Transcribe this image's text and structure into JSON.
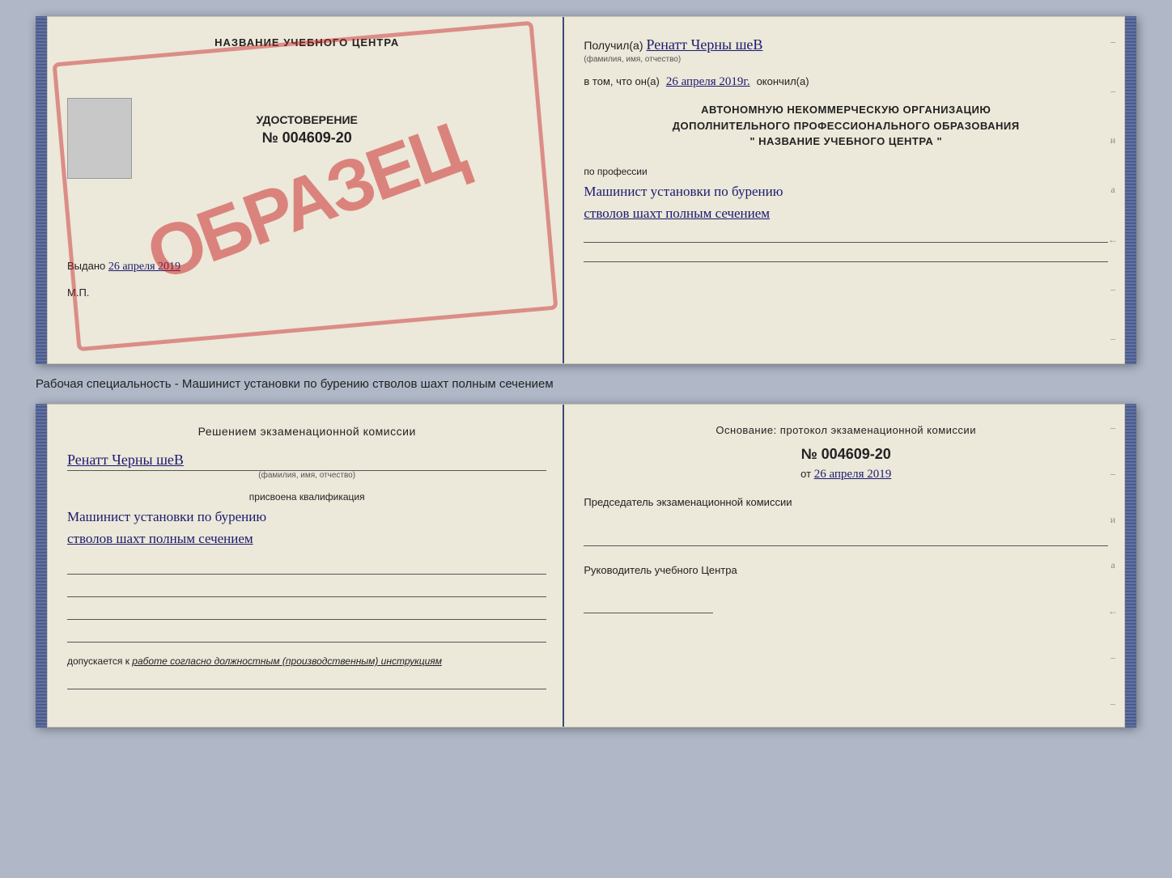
{
  "top_cert": {
    "left": {
      "title": "НАЗВАНИЕ УЧЕБНОГО ЦЕНТРА",
      "stamp": "ОБРАЗЕЦ",
      "stamp_border": true,
      "udostoverenie": "УДОСТОВЕРЕНИЕ",
      "number": "№ 004609-20",
      "photo": true,
      "vydano_label": "Выдано",
      "vydano_date": "26 апреля 2019",
      "mp": "М.П."
    },
    "right": {
      "poluchil": "Получил(а)",
      "name_handwritten": "Ренатт Черны шеВ",
      "name_hint": "(фамилия, имя, отчество)",
      "vtom_label": "в том, что он(а)",
      "date_handwritten": "26 апреля 2019г.",
      "okonchil": "окончил(а)",
      "org_line1": "АВТОНОМНУЮ НЕКОММЕРЧЕСКУЮ ОРГАНИЗАЦИЮ",
      "org_line2": "ДОПОЛНИТЕЛЬНОГО ПРОФЕССИОНАЛЬНОГО ОБРАЗОВАНИЯ",
      "org_line3": "\"  НАЗВАНИЕ УЧЕБНОГО ЦЕНТРА  \"",
      "po_professii": "по профессии",
      "profession_line1": "Машинист установки по бурению",
      "profession_line2": "стволов шахт полным сечением",
      "side_chars": [
        "–",
        "–",
        "и",
        "а",
        "←",
        "–",
        "–"
      ]
    }
  },
  "specialty_label": "Рабочая специальность - Машинист установки по бурению стволов шахт полным сечением",
  "bottom_cert": {
    "left": {
      "resheniyem": "Решением экзаменационной комиссии",
      "name_handwritten": "Ренатт Черны шеВ",
      "name_hint": "(фамилия, имя, отчество)",
      "prisvoena": "присвоена квалификация",
      "profession_line1": "Машинист установки по бурению",
      "profession_line2": "стволов шахт полным сечением",
      "dopuskaetsya": "допускается к",
      "dopuskaetsya_link": "работе согласно должностным (производственным) инструкциям"
    },
    "right": {
      "osnovanie": "Основание: протокол экзаменационной комиссии",
      "number": "№ 004609-20",
      "ot_label": "от",
      "date": "26 апреля 2019",
      "predsedatel": "Председатель экзаменационной комиссии",
      "rukovoditel": "Руководитель учебного Центра",
      "side_chars": [
        "–",
        "–",
        "и",
        "а",
        "←",
        "–",
        "–"
      ]
    }
  }
}
